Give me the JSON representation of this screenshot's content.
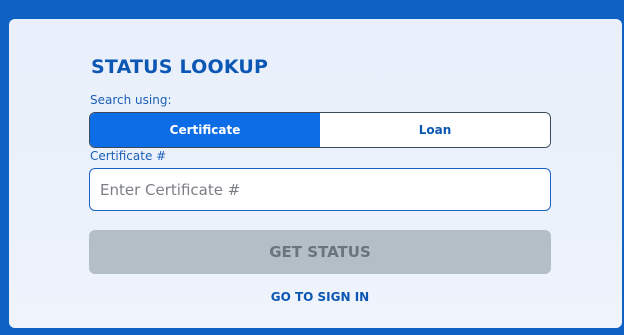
{
  "lookup": {
    "title": "STATUS LOOKUP",
    "search_label": "Search using:",
    "toggle": {
      "options": [
        "Certificate",
        "Loan"
      ],
      "selected": "Certificate"
    },
    "field": {
      "label": "Certificate #",
      "placeholder": "Enter Certificate #",
      "value": ""
    },
    "submit_label": "GET STATUS",
    "signin_label": "GO TO SIGN IN"
  },
  "colors": {
    "background": "#0f62c4",
    "card": "#e9f0fb",
    "accent": "#0c6de6",
    "heading": "#0b57b3",
    "disabled_button": "#b4bec7"
  }
}
